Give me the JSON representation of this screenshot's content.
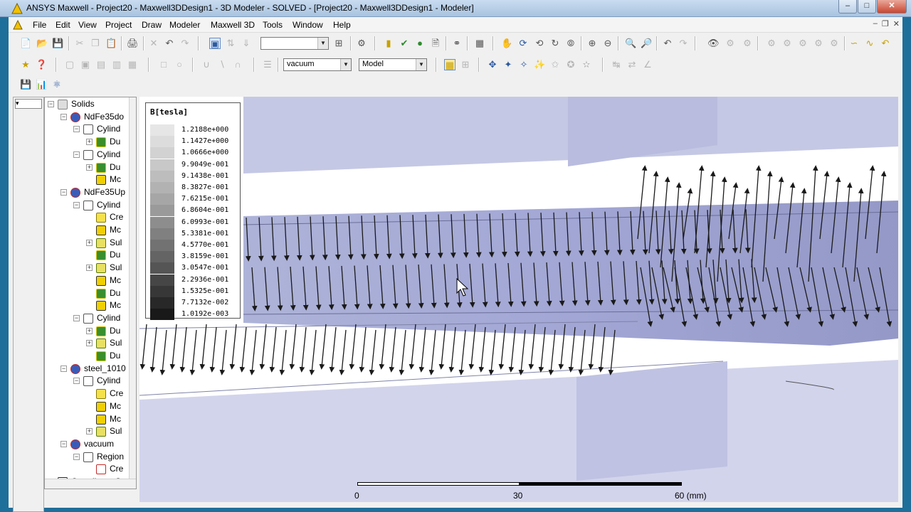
{
  "window": {
    "title": "ANSYS Maxwell - Project20 - Maxwell3DDesign1 - 3D Modeler - SOLVED - [Project20 - Maxwell3DDesign1 - Modeler]"
  },
  "menu": [
    "File",
    "Edit",
    "View",
    "Project",
    "Draw",
    "Modeler",
    "Maxwell 3D",
    "Tools",
    "Window",
    "Help"
  ],
  "toolbar": {
    "combo_empty": "",
    "material": "vacuum",
    "mode": "Model"
  },
  "tree": {
    "items": [
      {
        "label": "Solids",
        "icon": "solids-icon"
      },
      {
        "label": "NdFe35do",
        "icon": "material-icon"
      },
      {
        "label": "Cylind",
        "icon": "cylinder-icon"
      },
      {
        "label": "Du",
        "icon": "duplicate-icon"
      },
      {
        "label": "Cylind",
        "icon": "cylinder-icon"
      },
      {
        "label": "Du",
        "icon": "duplicate-icon"
      },
      {
        "label": "Mc",
        "icon": "move-icon"
      },
      {
        "label": "NdFe35Up",
        "icon": "material-icon"
      },
      {
        "label": "Cylind",
        "icon": "cylinder-icon"
      },
      {
        "label": "Cre",
        "icon": "create-icon"
      },
      {
        "label": "Mc",
        "icon": "move-icon"
      },
      {
        "label": "Sul",
        "icon": "subtract-icon"
      },
      {
        "label": "Du",
        "icon": "duplicate-icon"
      },
      {
        "label": "Sul",
        "icon": "subtract-icon"
      },
      {
        "label": "Mc",
        "icon": "move-icon"
      },
      {
        "label": "Du",
        "icon": "duplicate-icon"
      },
      {
        "label": "Mc",
        "icon": "move-icon"
      },
      {
        "label": "Cylind",
        "icon": "cylinder-icon"
      },
      {
        "label": "Du",
        "icon": "duplicate-icon"
      },
      {
        "label": "Sul",
        "icon": "subtract-icon"
      },
      {
        "label": "Du",
        "icon": "duplicate-icon"
      },
      {
        "label": "steel_1010",
        "icon": "material-icon"
      },
      {
        "label": "Cylind",
        "icon": "cylinder-icon"
      },
      {
        "label": "Cre",
        "icon": "create-icon"
      },
      {
        "label": "Mc",
        "icon": "move-icon"
      },
      {
        "label": "Mc",
        "icon": "move-icon"
      },
      {
        "label": "Sul",
        "icon": "subtract-icon"
      },
      {
        "label": "vacuum",
        "icon": "material-icon"
      },
      {
        "label": "Region",
        "icon": "cylinder-icon"
      },
      {
        "label": "Cre",
        "icon": "region-create-icon"
      },
      {
        "label": "Coordinate Sy",
        "icon": "coordinate-icon"
      }
    ]
  },
  "legend": {
    "title": "B[tesla]",
    "values": [
      "1.2188e+000",
      "1.1427e+000",
      "1.0666e+000",
      "9.9049e-001",
      "9.1438e-001",
      "8.3827e-001",
      "7.6215e-001",
      "6.8604e-001",
      "6.0993e-001",
      "5.3381e-001",
      "4.5770e-001",
      "3.8159e-001",
      "3.0547e-001",
      "2.2936e-001",
      "1.5325e-001",
      "7.7132e-002",
      "1.0192e-003"
    ],
    "shades": [
      "#e6e6e6",
      "#dcdcdc",
      "#d2d2d2",
      "#c8c8c8",
      "#bdbdbd",
      "#b2b2b2",
      "#a6a6a6",
      "#9a9a9a",
      "#8d8d8d",
      "#808080",
      "#727272",
      "#646464",
      "#555555",
      "#464646",
      "#373737",
      "#282828",
      "#191919"
    ]
  },
  "scale": {
    "labels": [
      "0",
      "30",
      "60 (mm)"
    ]
  }
}
